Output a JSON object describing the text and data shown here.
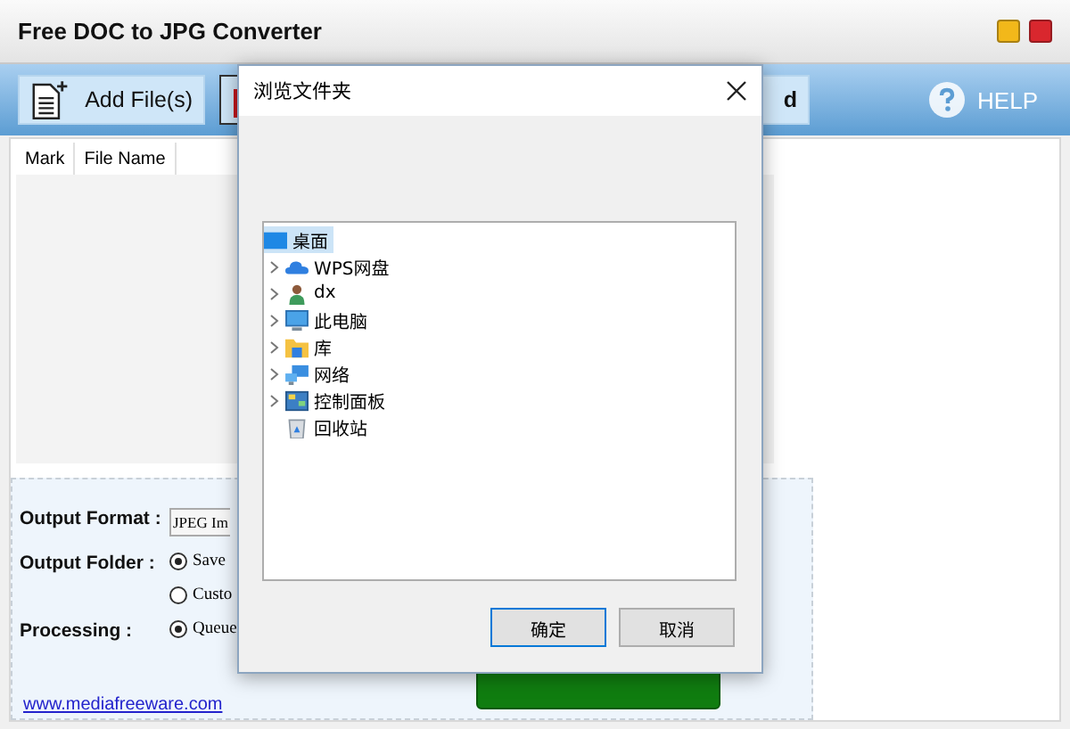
{
  "window": {
    "title": "Free DOC to JPG Converter"
  },
  "toolbar": {
    "buttons": [
      {
        "kind": "add",
        "label": "Add File(s)"
      },
      {
        "kind": "remove"
      },
      {
        "kind": "plain",
        "label": "d"
      }
    ],
    "help": "HELP"
  },
  "file_list": {
    "columns": [
      "Mark",
      "File Name"
    ]
  },
  "options": {
    "output_format": {
      "label": "Output Format :",
      "value": "JPEG Im"
    },
    "output_folder": {
      "label": "Output Folder :",
      "choices": [
        {
          "label": "Save",
          "selected": true
        },
        {
          "label": "Custo",
          "selected": false
        }
      ]
    },
    "processing": {
      "label": "Processing :",
      "choices": [
        {
          "label": "Queue",
          "selected": true
        }
      ]
    },
    "link": "www.mediafreeware.com"
  },
  "dialog": {
    "title": "浏览文件夹",
    "tree": [
      {
        "label": "桌面",
        "kind": "desktop",
        "selected": true,
        "expandable": false,
        "children": [
          {
            "label": "WPS网盘",
            "kind": "cloud",
            "selected": false,
            "expandable": true
          },
          {
            "label": "dx",
            "kind": "user",
            "selected": false,
            "expandable": true
          },
          {
            "label": "此电脑",
            "kind": "computer",
            "selected": false,
            "expandable": true
          },
          {
            "label": "库",
            "kind": "library",
            "selected": false,
            "expandable": true
          },
          {
            "label": "网络",
            "kind": "network",
            "selected": false,
            "expandable": true
          },
          {
            "label": "控制面板",
            "kind": "control",
            "selected": false,
            "expandable": true
          },
          {
            "label": "回收站",
            "kind": "bin",
            "selected": false,
            "expandable": false
          }
        ]
      }
    ],
    "buttons": [
      {
        "label": "确定",
        "selected": true
      },
      {
        "label": "取消",
        "selected": false
      }
    ]
  }
}
